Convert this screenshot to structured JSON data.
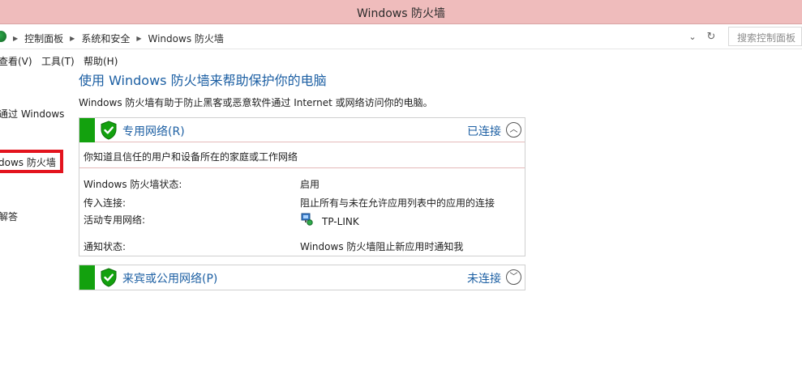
{
  "window": {
    "title": "Windows 防火墙"
  },
  "address": {
    "crumbs": [
      "控制面板",
      "系统和安全",
      "Windows 防火墙"
    ],
    "search_placeholder": "搜索控制面板"
  },
  "menu": {
    "view": "查看(V)",
    "tools": "工具(T)",
    "help": "帮助(H)"
  },
  "sidebar": {
    "items": [
      "通过 Windows",
      "dows 防火墙",
      "解答"
    ]
  },
  "main": {
    "heading": "使用 Windows 防火墙来帮助保护你的电脑",
    "description": "Windows 防火墙有助于防止黑客或恶意软件通过 Internet 或网络访问你的电脑。"
  },
  "private_network": {
    "title": "专用网络(R)",
    "status": "已连接",
    "note": "你知道且信任的用户和设备所在的家庭或工作网络",
    "rows": [
      {
        "label": "Windows 防火墙状态:",
        "value": "启用"
      },
      {
        "label": "传入连接:",
        "value": "阻止所有与未在允许应用列表中的应用的连接"
      },
      {
        "label": "活动专用网络:",
        "value": "TP-LINK"
      },
      {
        "label": "通知状态:",
        "value": "Windows 防火墙阻止新应用时通知我"
      }
    ]
  },
  "public_network": {
    "title": "来宾或公用网络(P)",
    "status": "未连接"
  },
  "colors": {
    "accent": "#1c5fa3",
    "titlebar": "#efbcbc",
    "shield_green": "#13a10e",
    "highlight": "#e3141e"
  }
}
